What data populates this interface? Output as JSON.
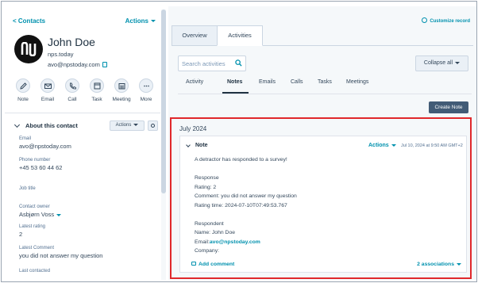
{
  "left": {
    "back_label": "< Contacts",
    "actions_label": "Actions",
    "contact_name": "John Doe",
    "company": "nps.today",
    "email": "avo@npstoday.com",
    "quick_actions": [
      {
        "label": "Note",
        "icon": "note-icon"
      },
      {
        "label": "Email",
        "icon": "email-icon"
      },
      {
        "label": "Call",
        "icon": "call-icon"
      },
      {
        "label": "Task",
        "icon": "task-icon"
      },
      {
        "label": "Meeting",
        "icon": "meeting-icon"
      },
      {
        "label": "More",
        "icon": "more-icon"
      }
    ],
    "about_title": "About this contact",
    "about_actions_label": "Actions",
    "properties": [
      {
        "label": "Email",
        "value": "avo@npstoday.com"
      },
      {
        "label": "Phone number",
        "value": "+45 53 60 44 62"
      },
      {
        "label": "Job title",
        "value": ""
      },
      {
        "label": "Contact owner",
        "value": "Asbjørn Voss"
      },
      {
        "label": "Latest rating",
        "value": "2"
      },
      {
        "label": "Latest Comment",
        "value": "you did not answer my question"
      },
      {
        "label": "Last contacted",
        "value": ""
      }
    ]
  },
  "right": {
    "customize_label": "Customize record",
    "tabs": [
      "Overview",
      "Activities"
    ],
    "active_tab": "Activities",
    "search_placeholder": "Search activities",
    "collapse_label": "Collapse all",
    "subtabs": [
      "Activity",
      "Notes",
      "Emails",
      "Calls",
      "Tasks",
      "Meetings"
    ],
    "active_subtab": "Notes",
    "create_note_label": "Create Note",
    "month": "July 2024",
    "note": {
      "title": "Note",
      "actions_label": "Actions",
      "date": "Jul 10, 2024 at 9:50 AM GMT+2",
      "intro": "A detractor has responded to a survey!",
      "response_heading": "Response",
      "rating": "Rating: 2",
      "comment": "Comment: you did not answer my question",
      "rating_time": "Rating time: 2024-07-10T07:49:53.767",
      "respondent_heading": "Respondent",
      "respondent_name": "Name: John Doe",
      "respondent_email_label": "Email:",
      "respondent_email": "avo@npstoday.com",
      "company_label": "Company:",
      "add_comment_label": "Add comment",
      "associations_label": "2 associations"
    }
  },
  "colors": {
    "accent": "#0091ae",
    "highlight_border": "#e0282b",
    "primary_button": "#425b76"
  }
}
